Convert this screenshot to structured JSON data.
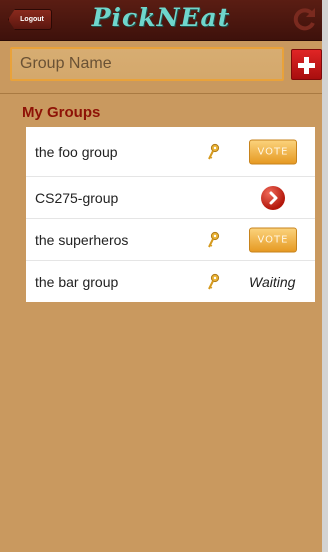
{
  "header": {
    "logout_label": "Logout",
    "title": "PickNEat"
  },
  "new_group": {
    "placeholder": "Group Name",
    "value": ""
  },
  "section_title": "My Groups",
  "groups": [
    {
      "name": "the foo group",
      "has_key": true,
      "action": "vote",
      "action_label": "VOTE"
    },
    {
      "name": "CS275-group",
      "has_key": false,
      "action": "go",
      "action_label": ""
    },
    {
      "name": "the superheros",
      "has_key": true,
      "action": "vote",
      "action_label": "VOTE"
    },
    {
      "name": "the bar group",
      "has_key": true,
      "action": "waiting",
      "action_label": "Waiting"
    }
  ],
  "colors": {
    "background": "#c9995f",
    "header": "#4a150e",
    "accent_teal": "#6fd6cc",
    "section_title": "#8e1206",
    "vote_button": "#f0b048",
    "add_button": "#d21c1c"
  }
}
